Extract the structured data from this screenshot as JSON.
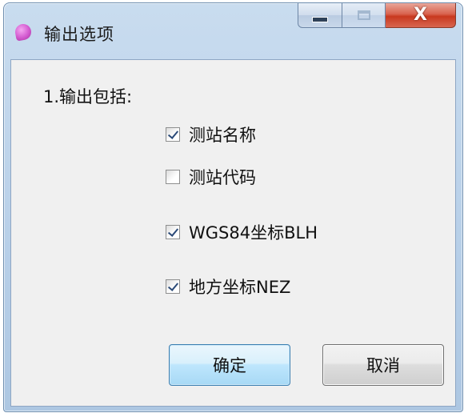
{
  "window": {
    "title": "输出选项",
    "caption_buttons": {
      "minimize_icon": "minimize-icon",
      "maximize_icon": "maximize-icon",
      "close_icon": "close-icon",
      "close_glyph": "X"
    }
  },
  "output": {
    "section_label": "1.输出包括:",
    "options": [
      {
        "label": "测站名称",
        "checked": true
      },
      {
        "label": "测站代码",
        "checked": false
      },
      {
        "label": "WGS84坐标BLH",
        "checked": true
      },
      {
        "label": "地方坐标NEZ",
        "checked": true
      }
    ]
  },
  "buttons": {
    "ok_label": "确定",
    "cancel_label": "取消"
  },
  "colors": {
    "close_button": "#c8391f",
    "ok_button_border": "#3c7fb1",
    "dialog_background": "#f0f0f0"
  }
}
